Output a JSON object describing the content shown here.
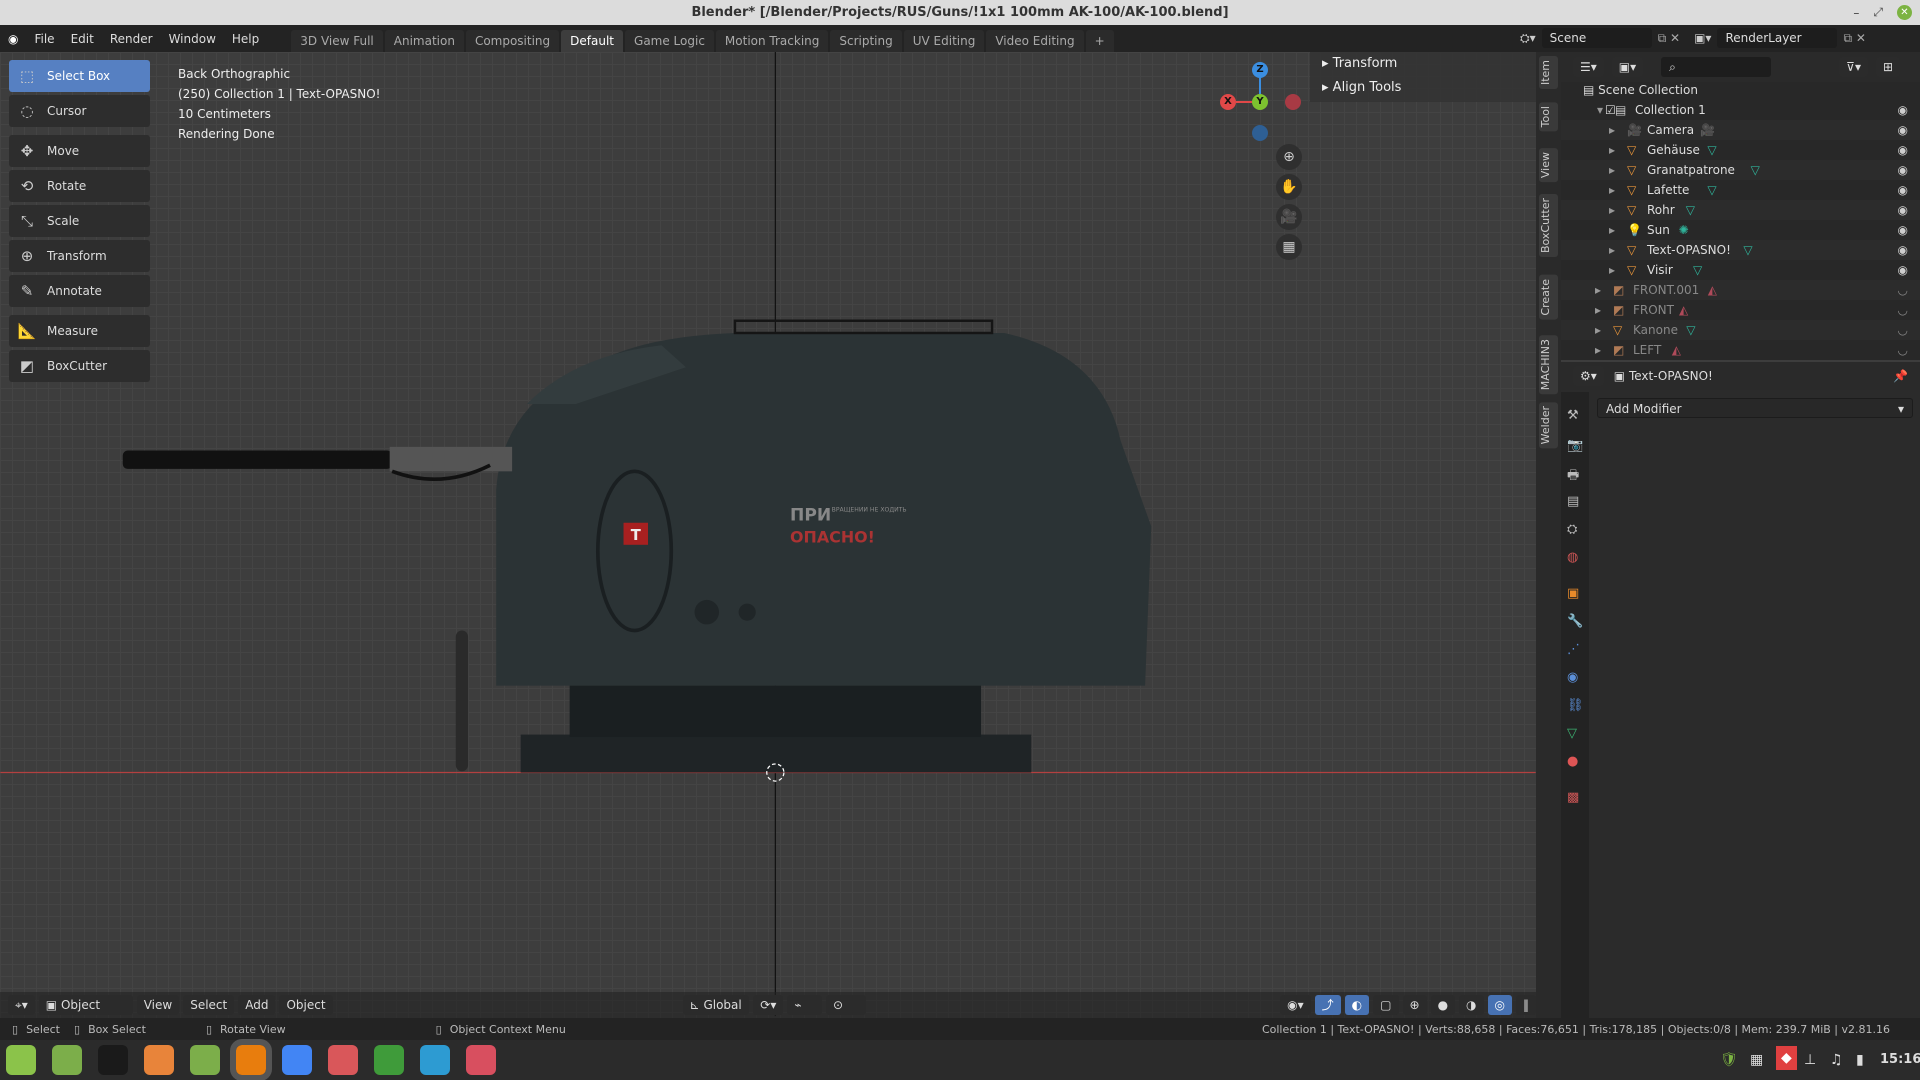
{
  "window": {
    "title": "Blender* [/Blender/Projects/RUS/Guns/!1x1 100mm AK-100/AK-100.blend]",
    "controls": [
      "–",
      "⤢",
      "✕"
    ]
  },
  "menu": [
    "File",
    "Edit",
    "Render",
    "Window",
    "Help"
  ],
  "workspaces": [
    {
      "label": "3D View Full"
    },
    {
      "label": "Animation"
    },
    {
      "label": "Compositing"
    },
    {
      "label": "Default",
      "active": true
    },
    {
      "label": "Game Logic"
    },
    {
      "label": "Motion Tracking"
    },
    {
      "label": "Scripting"
    },
    {
      "label": "UV Editing"
    },
    {
      "label": "Video Editing"
    },
    {
      "label": "+"
    }
  ],
  "scene": {
    "name": "Scene",
    "view_layer": "RenderLayer"
  },
  "tools": [
    {
      "label": "Select Box",
      "icon": "select-box-icon",
      "glyph": "⬚",
      "active": true
    },
    {
      "label": "Cursor",
      "icon": "cursor-icon",
      "glyph": "◌"
    },
    {
      "label": "Move",
      "icon": "move-icon",
      "glyph": "✥"
    },
    {
      "label": "Rotate",
      "icon": "rotate-icon",
      "glyph": "⟲"
    },
    {
      "label": "Scale",
      "icon": "scale-icon",
      "glyph": "⤡"
    },
    {
      "label": "Transform",
      "icon": "transform-icon",
      "glyph": "⊕"
    },
    {
      "label": "Annotate",
      "icon": "annotate-icon",
      "glyph": "✎"
    },
    {
      "label": "Measure",
      "icon": "measure-icon",
      "glyph": "📐"
    },
    {
      "label": "BoxCutter",
      "icon": "boxcutter-icon",
      "glyph": "◩"
    }
  ],
  "viewport": {
    "view": "Back Orthographic",
    "context": "(250) Collection 1 | Text-OPASNO!",
    "scale": "10 Centimeters",
    "render_status": "Rendering Done",
    "model_text_top": "ПРИ",
    "model_text_small": "ВРАЩЕНИИ НЕ ХОДИТЬ",
    "model_text_warning": "ОПАСНО!",
    "model_badge": "T"
  },
  "gizmo": {
    "z": "Z",
    "y": "Y",
    "x": "X",
    "colors": {
      "x": "#e04848",
      "y": "#7dc22f",
      "z": "#3b8ee0"
    }
  },
  "npanel": {
    "sections": [
      "Transform",
      "Align Tools"
    ]
  },
  "side_tabs": [
    "Item",
    "Tool",
    "View",
    "BoxCutter",
    "Create",
    "MACHIN3",
    "Welder"
  ],
  "viewport_header": {
    "mode": "Object Mode",
    "menus": [
      "View",
      "Select",
      "Add",
      "Object"
    ],
    "orientation": "Global"
  },
  "outliner": {
    "root": "Scene Collection",
    "items": [
      {
        "name": "Collection 1",
        "type": "collection",
        "level": 1,
        "visible": true
      },
      {
        "name": "Camera",
        "type": "camera",
        "level": 2,
        "visible": true
      },
      {
        "name": "Gehäuse",
        "type": "mesh",
        "level": 2,
        "visible": true
      },
      {
        "name": "Granatpatrone",
        "type": "mesh",
        "level": 2,
        "visible": true
      },
      {
        "name": "Lafette",
        "type": "mesh",
        "level": 2,
        "visible": true
      },
      {
        "name": "Rohr",
        "type": "mesh",
        "level": 2,
        "visible": true
      },
      {
        "name": "Sun",
        "type": "light",
        "level": 2,
        "visible": true
      },
      {
        "name": "Text-OPASNO!",
        "type": "mesh",
        "level": 2,
        "visible": true
      },
      {
        "name": "Visir",
        "type": "mesh",
        "level": 2,
        "visible": true
      },
      {
        "name": "FRONT.001",
        "type": "image",
        "level": 1,
        "visible": false
      },
      {
        "name": "FRONT",
        "type": "image",
        "level": 1,
        "visible": false
      },
      {
        "name": "Kanone",
        "type": "mesh",
        "level": 1,
        "visible": false
      },
      {
        "name": "LEFT",
        "type": "image",
        "level": 1,
        "visible": false
      }
    ]
  },
  "properties": {
    "object": "Text-OPASNO!",
    "add_modifier": "Add Modifier"
  },
  "statusbar": {
    "select": "Select",
    "box_select": "Box Select",
    "rotate_view": "Rotate View",
    "context_menu": "Object Context Menu",
    "stats": "Collection 1 | Text-OPASNO! | Verts:88,658 | Faces:76,651 | Tris:178,185 | Objects:0/8 | Mem: 239.7 MiB | v2.81.16"
  },
  "taskbar": {
    "apps": [
      {
        "icon": "mint-menu-icon",
        "color": "#8bc34a"
      },
      {
        "icon": "show-desktop-icon",
        "color": "#7cae4a"
      },
      {
        "icon": "terminal-icon",
        "color": "#1a1a1a"
      },
      {
        "icon": "firefox-icon",
        "color": "#e8843a"
      },
      {
        "icon": "files-icon",
        "color": "#7cae4a"
      },
      {
        "icon": "blender-icon",
        "color": "#e87d0d"
      },
      {
        "icon": "chrome-icon",
        "color": "#4285f4"
      },
      {
        "icon": "reader-icon",
        "color": "#d9575a"
      },
      {
        "icon": "calc-icon",
        "color": "#3f9b3a"
      },
      {
        "icon": "monitor-icon",
        "color": "#2d9bd2"
      },
      {
        "icon": "image-viewer-icon",
        "color": "#d84f5f"
      }
    ],
    "clock": "15:16"
  }
}
